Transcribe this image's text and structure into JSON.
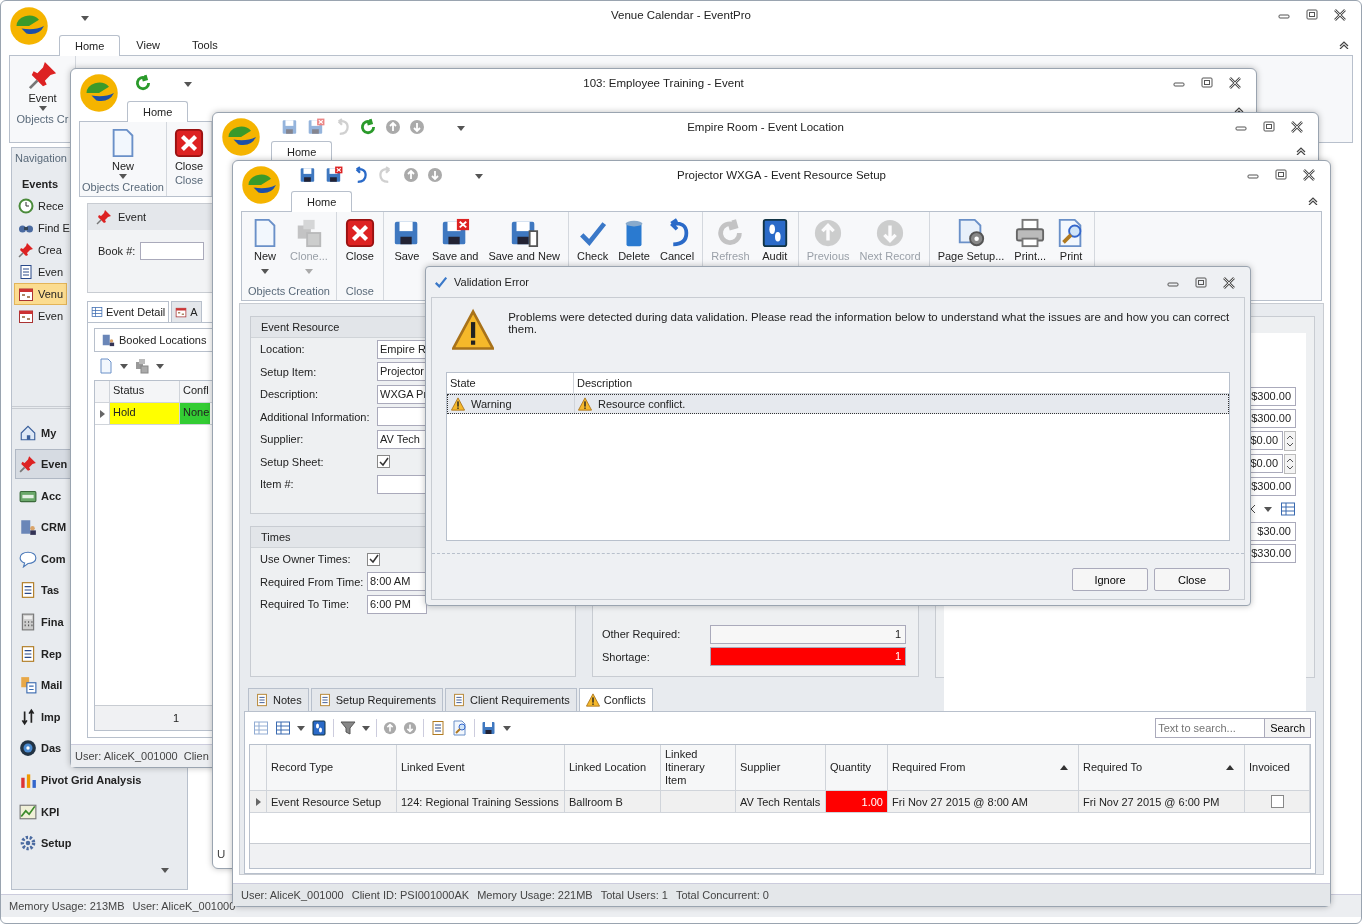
{
  "main_window": {
    "title": "Venue Calendar - EventPro",
    "tabs": [
      {
        "label": "Home",
        "selected": true
      },
      {
        "label": "View",
        "selected": false
      },
      {
        "label": "Tools",
        "selected": false
      }
    ],
    "ribbon_button": "Event",
    "ribbon_group": "Objects Cr",
    "navigation": {
      "title": "Navigation",
      "section": "Events",
      "items": [
        {
          "label": "Rece",
          "selected": false
        },
        {
          "label": "Find E",
          "selected": false
        },
        {
          "label": "Crea",
          "selected": false
        },
        {
          "label": "Even",
          "selected": false
        },
        {
          "label": "Venu",
          "selected": true
        },
        {
          "label": "Even",
          "selected": false
        }
      ]
    },
    "modules": [
      {
        "label": "My",
        "selected": false
      },
      {
        "label": "Even",
        "selected": true
      },
      {
        "label": "Acc",
        "selected": false
      },
      {
        "label": "CRM",
        "selected": false
      },
      {
        "label": "Com",
        "selected": false
      },
      {
        "label": "Tas",
        "selected": false
      },
      {
        "label": "Fina",
        "selected": false
      },
      {
        "label": "Rep",
        "selected": false
      },
      {
        "label": "Mail",
        "selected": false
      },
      {
        "label": "Imp",
        "selected": false
      },
      {
        "label": "Das",
        "selected": false
      },
      {
        "label": "Pivot Grid Analysis",
        "selected": false
      },
      {
        "label": "KPI",
        "selected": false
      },
      {
        "label": "Setup",
        "selected": false
      }
    ],
    "status_bar": [
      "Memory Usage: 213MB",
      "User: AliceK_001000"
    ]
  },
  "event_window": {
    "title": "103: Employee Training - Event",
    "tab": "Home",
    "buttons": [
      "New",
      "Close"
    ],
    "groups": [
      "Objects Creation",
      "Close"
    ],
    "panel_title": "Event",
    "book_label": "Book #:",
    "tabs": [
      {
        "label": "Event Detail",
        "selected": true
      },
      {
        "label": "A",
        "selected": false
      }
    ],
    "subtab": "Booked Locations",
    "grid": {
      "columns": [
        "Status",
        "Confl"
      ],
      "rows": [
        {
          "cells": [
            {
              "text": "Hold",
              "color": "#ffff00"
            },
            {
              "text": "None",
              "color": "#33cc33"
            }
          ]
        }
      ],
      "footer": "1"
    },
    "status_bar": [
      "User: AliceK_001000",
      "Clien"
    ]
  },
  "location_window": {
    "title": "Empire Room - Event Location",
    "tab": "Home",
    "status_bar": "U"
  },
  "resource_window": {
    "title": "Projector WXGA - Event Resource Setup",
    "tab": "Home",
    "ribbon_groups": [
      {
        "label": "Objects Creation",
        "buttons": [
          {
            "label": "New",
            "disabled": false,
            "dropdown": true
          },
          {
            "label": "Clone...",
            "disabled": true,
            "dropdown": true
          }
        ]
      },
      {
        "label": "Close",
        "buttons": [
          {
            "label": "Close",
            "disabled": false
          }
        ]
      },
      {
        "buttons": [
          {
            "label": "Save",
            "disabled": false
          },
          {
            "label": "Save and",
            "disabled": false
          },
          {
            "label": "Save and New",
            "disabled": false
          }
        ]
      },
      {
        "buttons": [
          {
            "label": "Check",
            "disabled": false
          },
          {
            "label": "Delete",
            "disabled": false
          },
          {
            "label": "Cancel",
            "disabled": false
          }
        ]
      },
      {
        "buttons": [
          {
            "label": "Refresh",
            "disabled": true
          },
          {
            "label": "Audit",
            "disabled": false
          }
        ]
      },
      {
        "buttons": [
          {
            "label": "Previous",
            "disabled": true
          },
          {
            "label": "Next Record",
            "disabled": true
          }
        ]
      },
      {
        "buttons": [
          {
            "label": "Page Setup...",
            "disabled": false
          },
          {
            "label": "Print...",
            "disabled": false
          },
          {
            "label": "Print",
            "disabled": false
          }
        ]
      }
    ],
    "resource": {
      "title": "Event Resource",
      "fields": [
        {
          "kind": "text",
          "label": "Location:",
          "value": "Empire R"
        },
        {
          "kind": "text",
          "label": "Setup Item:",
          "value": "Projector"
        },
        {
          "kind": "text",
          "label": "Description:",
          "value": "WXGA Pr"
        },
        {
          "kind": "text",
          "label": "Additional Information:"
        },
        {
          "kind": "text",
          "label": "Supplier:",
          "value": "AV Tech"
        },
        {
          "kind": "check",
          "label": "Setup Sheet:",
          "checked": true
        },
        {
          "kind": "text",
          "label": "Item #:"
        }
      ]
    },
    "times": {
      "title": "Times",
      "fields": [
        {
          "kind": "check",
          "label": "Use Owner Times:",
          "checked": true
        },
        {
          "kind": "text",
          "label": "Required From Time:",
          "value": "8:00 AM"
        },
        {
          "kind": "text",
          "label": "Required To Time:",
          "value": "6:00 PM"
        }
      ]
    },
    "availability": [
      {
        "label": "Other Required:",
        "value": "1",
        "alert": false
      },
      {
        "label": "Shortage:",
        "value": "1",
        "alert": true
      }
    ],
    "amounts": [
      {
        "kind": "amount",
        "value": "$300.00"
      },
      {
        "kind": "amount",
        "value": "$300.00"
      },
      {
        "kind": "spin",
        "value": "$0.00"
      },
      {
        "kind": "spin",
        "value": "$0.00"
      },
      {
        "kind": "amount",
        "value": "$300.00"
      },
      {
        "kind": "combo"
      },
      {
        "kind": "amount",
        "value": "$30.00"
      },
      {
        "kind": "amount",
        "value": "$330.00"
      }
    ],
    "tabs": [
      {
        "label": "Notes",
        "selected": false
      },
      {
        "label": "Setup Requirements",
        "selected": false
      },
      {
        "label": "Client Requirements",
        "selected": false
      },
      {
        "label": "Conflicts",
        "selected": true
      }
    ],
    "search": {
      "placeholder": "Text to search...",
      "button": "Search"
    },
    "grid": {
      "columns": [
        {
          "label": "Record Type",
          "sorted": false
        },
        {
          "label": "Linked Event",
          "sorted": false
        },
        {
          "label": "Linked Location",
          "sorted": false
        },
        {
          "label": "Linked Itinerary Item",
          "sorted": false
        },
        {
          "label": "Supplier",
          "sorted": false
        },
        {
          "label": "Quantity",
          "sorted": false
        },
        {
          "label": "Required From",
          "sorted": true
        },
        {
          "label": "Required To",
          "sorted": true
        },
        {
          "label": "Invoiced",
          "sorted": false
        }
      ],
      "rows": [
        {
          "record_type": "Event Resource Setup",
          "linked_event": "124: Regional Training Sessions",
          "linked_location": "Ballroom B",
          "supplier": "AV Tech Rentals",
          "quantity": "1.00",
          "quantity_alert": true,
          "required_from": "Fri Nov 27 2015 @ 8:00 AM",
          "required_to": "Fri Nov 27 2015 @ 6:00 PM",
          "invoiced": false
        }
      ]
    },
    "status_bar": [
      "User: AliceK_001000",
      "Client ID: PSI001000AK",
      "Memory Usage: 221MB",
      "Total Users: 1",
      "Total Concurrent: 0"
    ]
  },
  "dialog": {
    "title": "Validation Error",
    "message": "Problems were detected during data validation. Please read the information below to understand what the issues are and how you can correct them.",
    "columns": [
      "State",
      "Description"
    ],
    "rows": [
      {
        "state": "Warning",
        "description": "Resource conflict.",
        "selected": true
      }
    ],
    "buttons": [
      "Ignore",
      "Close"
    ]
  }
}
